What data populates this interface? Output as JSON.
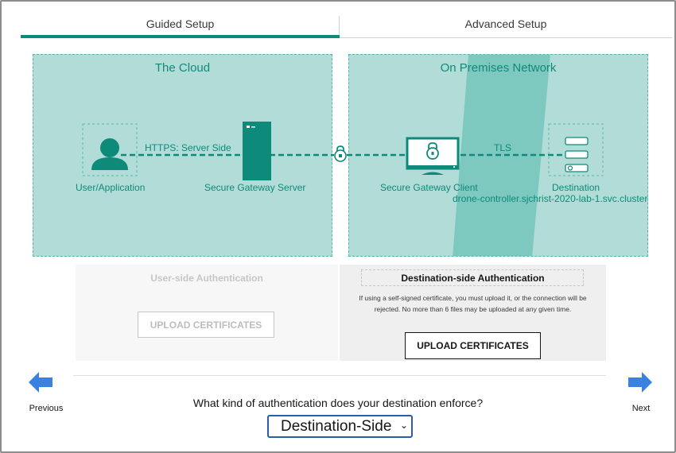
{
  "tabs": {
    "guided": "Guided Setup",
    "advanced": "Advanced Setup"
  },
  "cloud_panel": {
    "title": "The Cloud",
    "user_label": "User/Application",
    "link_label": "HTTPS: Server Side",
    "server_label": "Secure Gateway Server"
  },
  "prem_panel": {
    "title": "On Premises Network",
    "client_label": "Secure Gateway Client",
    "link_label": "TLS",
    "destination_label": "Destination",
    "destination_host": "drone-controller.sjchrist-2020-lab-1.svc.cluster"
  },
  "user_auth": {
    "title": "User-side Authentication",
    "button": "UPLOAD CERTIFICATES"
  },
  "dest_auth": {
    "title": "Destination-side Authentication",
    "description": "If using a self-signed certificate, you must upload it, or the connection will be rejected. No more than 6 files may be uploaded at any given time.",
    "button": "UPLOAD CERTIFICATES"
  },
  "question": "What kind of authentication does your destination enforce?",
  "auth_select": {
    "value": "Destination-Side"
  },
  "nav": {
    "previous": "Previous",
    "next": "Next"
  },
  "colors": {
    "accent": "#0e8a7b",
    "panel_bg": "#b2dcd7",
    "stripe": "#7ec9bf",
    "nav_arrow": "#3b82e0",
    "select_border": "#2c5dad"
  }
}
